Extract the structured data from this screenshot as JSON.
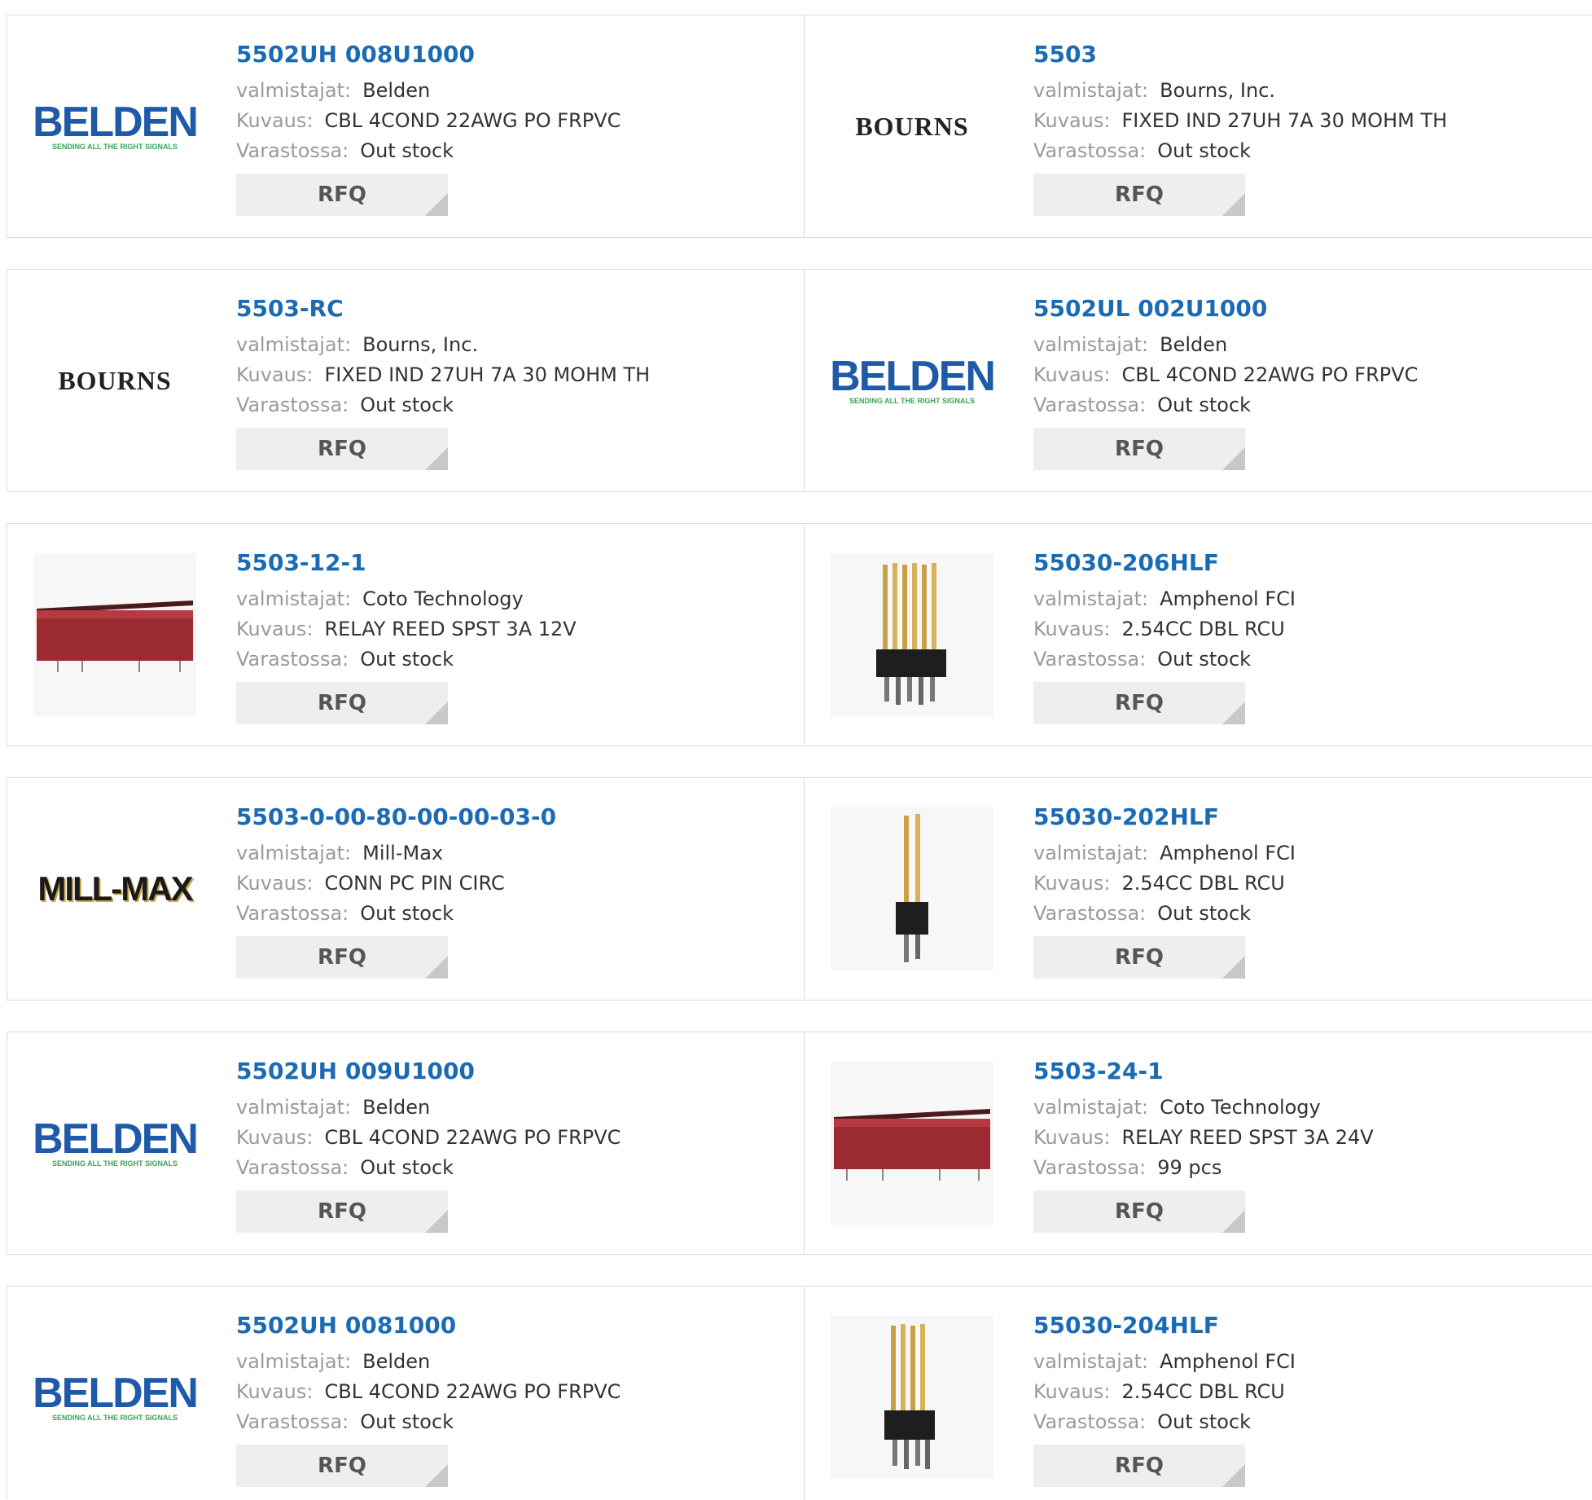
{
  "labels": {
    "manufacturer": "valmistajat:",
    "description": "Kuvaus:",
    "stock": "Varastossa:",
    "rfq": "RFQ"
  },
  "colors": {
    "link": "#1a6bb4",
    "label": "#9a9a9a",
    "value": "#333333",
    "button_bg": "#eeeeee",
    "border": "#dcdcdc"
  },
  "logo_text": {
    "belden": "BELDEN",
    "belden_tagline": "SENDING ALL THE RIGHT SIGNALS",
    "bourns": "BOURNS",
    "millmax": "MILL-MAX"
  },
  "products": [
    {
      "part": "5502UH 008U1000",
      "manufacturer": "Belden",
      "description": "CBL 4COND 22AWG PO FRPVC",
      "stock": "Out stock",
      "image": "belden-logo"
    },
    {
      "part": "5503",
      "manufacturer": "Bourns, Inc.",
      "description": "FIXED IND 27UH 7A 30 MOHM TH",
      "stock": "Out stock",
      "image": "bourns-logo"
    },
    {
      "part": "5503-RC",
      "manufacturer": "Bourns, Inc.",
      "description": "FIXED IND 27UH 7A 30 MOHM TH",
      "stock": "Out stock",
      "image": "bourns-logo"
    },
    {
      "part": "5502UL 002U1000",
      "manufacturer": "Belden",
      "description": "CBL 4COND 22AWG PO FRPVC",
      "stock": "Out stock",
      "image": "belden-logo"
    },
    {
      "part": "5503-12-1",
      "manufacturer": "Coto Technology",
      "description": "RELAY REED SPST 3A 12V",
      "stock": "Out stock",
      "image": "reed-relay-photo"
    },
    {
      "part": "55030-206HLF",
      "manufacturer": "Amphenol FCI",
      "description": "2.54CC DBL RCU",
      "stock": "Out stock",
      "image": "pin-header-6-photo"
    },
    {
      "part": "5503-0-00-80-00-00-03-0",
      "manufacturer": "Mill-Max",
      "description": "CONN PC PIN CIRC",
      "stock": "Out stock",
      "image": "millmax-logo"
    },
    {
      "part": "55030-202HLF",
      "manufacturer": "Amphenol FCI",
      "description": "2.54CC DBL RCU",
      "stock": "Out stock",
      "image": "pin-header-2-photo"
    },
    {
      "part": "5502UH 009U1000",
      "manufacturer": "Belden",
      "description": "CBL 4COND 22AWG PO FRPVC",
      "stock": "Out stock",
      "image": "belden-logo"
    },
    {
      "part": "5503-24-1",
      "manufacturer": "Coto Technology",
      "description": "RELAY REED SPST 3A 24V",
      "stock": "99 pcs",
      "image": "reed-relay-photo"
    },
    {
      "part": "5502UH 0081000",
      "manufacturer": "Belden",
      "description": "CBL 4COND 22AWG PO FRPVC",
      "stock": "Out stock",
      "image": "belden-logo"
    },
    {
      "part": "55030-204HLF",
      "manufacturer": "Amphenol FCI",
      "description": "2.54CC DBL RCU",
      "stock": "Out stock",
      "image": "pin-header-4-photo"
    }
  ]
}
